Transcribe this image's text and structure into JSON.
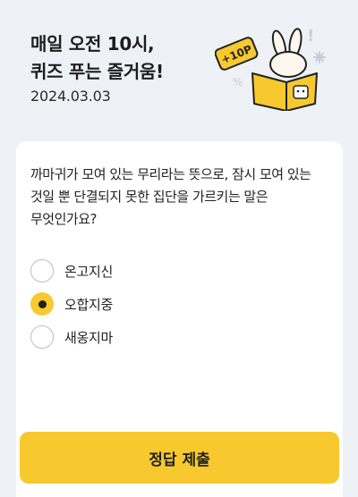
{
  "header": {
    "title": "매일 오전 10시,\n퀴즈 푸는 즐거움!",
    "date": "2024.03.03",
    "badge": "+10P"
  },
  "quiz": {
    "question": "까마귀가 모여 있는 무리라는 뜻으로, 잠시 모여 있는 것일 뿐 단결되지 못한 집단을 가르키는 말은 무엇인가요?",
    "options": [
      {
        "label": "온고지신",
        "selected": false
      },
      {
        "label": "오합지중",
        "selected": true
      },
      {
        "label": "새옹지마",
        "selected": false
      }
    ]
  },
  "submit_label": "정답 제출",
  "colors": {
    "accent": "#f7c92f",
    "background": "#eef1f6"
  }
}
